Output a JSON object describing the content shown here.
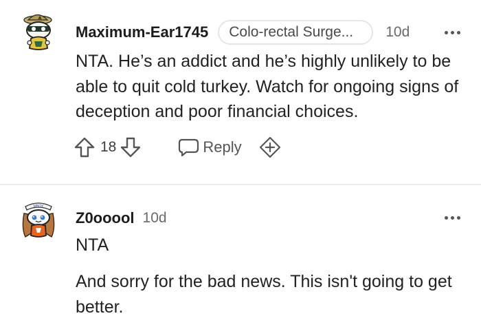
{
  "comments": [
    {
      "username": "Maximum-Ear1745",
      "flair": "Colo-rectal Surge...",
      "time": "10d",
      "body": [
        "NTA. He’s an addict and he’s highly unlikely to be able to quit cold turkey. Watch for ongoing signs of deception and poor financial choices."
      ],
      "votes": "18",
      "reply_label": "Reply",
      "avatar_icon": "snoo-avatar-icon"
    },
    {
      "username": "Z0ooool",
      "time": "10d",
      "body": [
        "NTA",
        "And sorry for the bad news. This isn't going to get better."
      ],
      "avatar_icon": "snoo-avatar-icon"
    }
  ],
  "avatar_badge_text": "MBOY",
  "colors": {
    "text": "#222222",
    "muted": "#6a6a6a",
    "divider": "#ececec",
    "flair_border": "#e6e6e6"
  }
}
